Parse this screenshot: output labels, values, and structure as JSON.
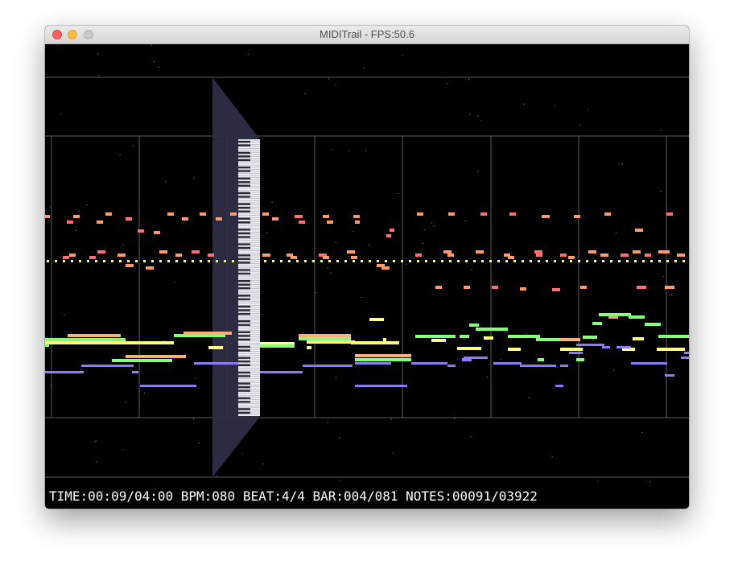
{
  "window": {
    "title": "MIDITrail - FPS:50.6",
    "buttons": [
      "close",
      "minimize",
      "zoom"
    ]
  },
  "status_bar": {
    "text": "TIME:00:09/04:00 BPM:080 BEAT:4/4 BAR:004/081 NOTES:00091/03922"
  },
  "colors": {
    "background": "#000000",
    "keyboard_plane": "#3a3a52",
    "note_red": "#ff6f6f",
    "note_salmon": "#ff9a6e",
    "note_orange": "#ffb07a",
    "note_yellow": "#ffff80",
    "note_green": "#88ff7a",
    "note_blue": "#8c7cf5",
    "grid_line": "#6a6a6a"
  },
  "icons": [
    "piano-keyboard-icon"
  ]
}
